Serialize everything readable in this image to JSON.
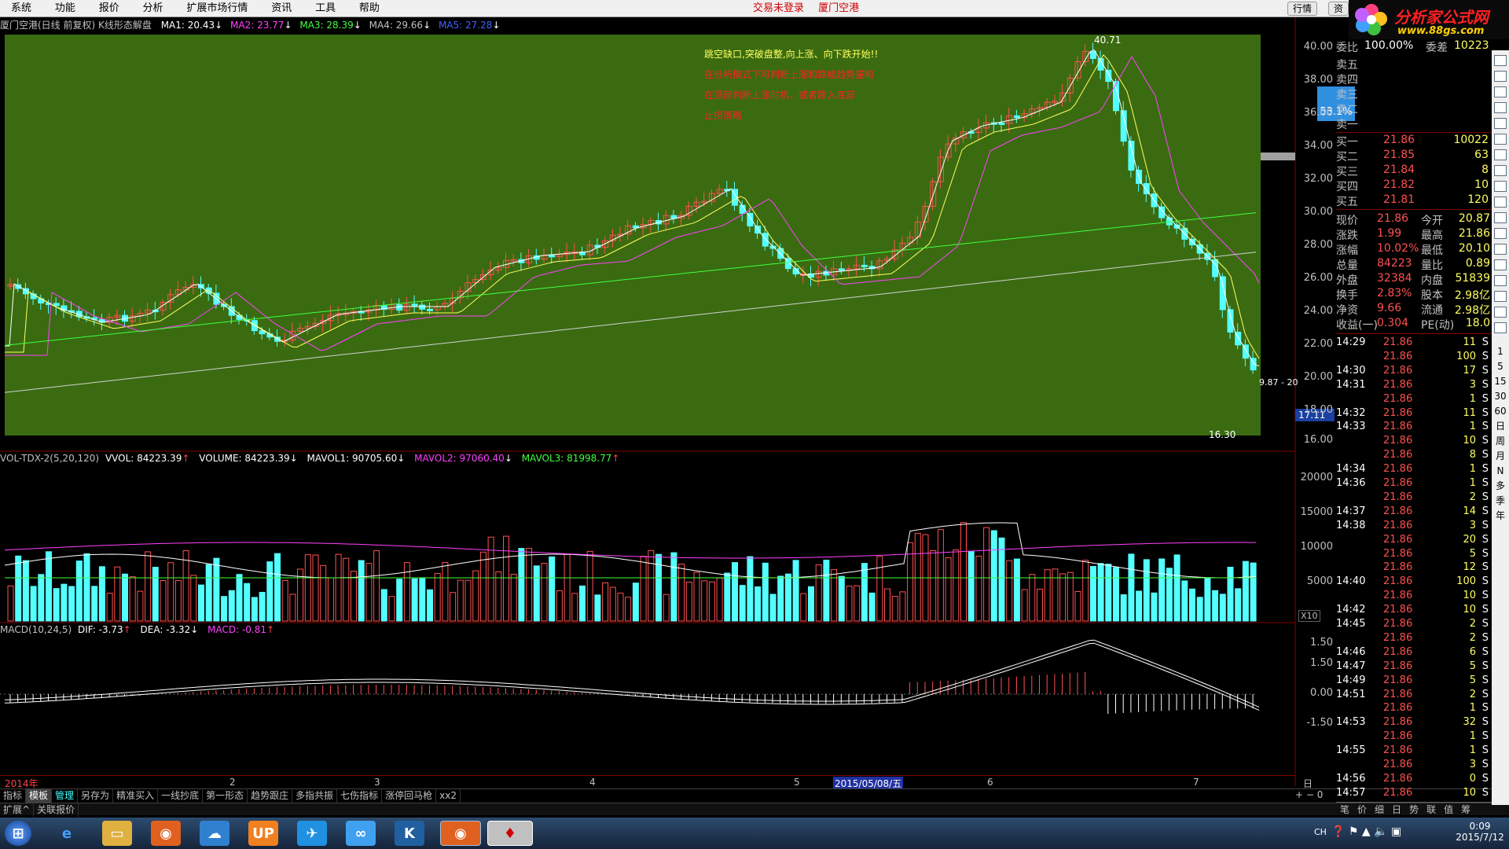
{
  "menu": [
    "系统",
    "功能",
    "报价",
    "分析",
    "扩展市场行情",
    "资讯",
    "工具",
    "帮助"
  ],
  "login_info": "交易未登录",
  "stock_title": "厦门空港",
  "top_buttons": [
    "行情",
    "资"
  ],
  "logo_text": "分析家公式网",
  "logo_url": "www.88gs.com",
  "chart_header": {
    "name": "厦门空港(日线 前复权) K线形态解盘",
    "ma1": "MA1: 20.43",
    "ma2": "MA2: 23.77",
    "ma3": "MA3: 28.39",
    "ma4": "MA4: 29.66",
    "ma5": "MA5: 27.28"
  },
  "annotations": {
    "line1": "跳空缺口,突破盘整,向上涨、向下跌开始!!",
    "line2": "在分析模式下可判断上涨和跌幅趋势量和",
    "line3": "在顶部判断上涨时机，或者跌入底部",
    "line4": "止损策略",
    "high_label": "40.71",
    "low_label": "16.30",
    "price_tag": "17.11",
    "scale_tag": "9.87 - 20",
    "pct_badge": "53.1%"
  },
  "price_axis": [
    "40.00",
    "38.00",
    "36.00",
    "34.00",
    "32.00",
    "30.00",
    "28.00",
    "26.00",
    "24.00",
    "22.00",
    "20.00",
    "18.00",
    "16.00"
  ],
  "vol_header": {
    "name": "VOL-TDX-2(5,20,120)",
    "vvol": "VVOL: 84223.39",
    "volume": "VOLUME: 84223.39",
    "mavol1": "MAVOL1: 90705.60",
    "mavol2": "MAVOL2: 97060.40",
    "mavol3": "MAVOL3: 81998.77"
  },
  "vol_axis": [
    "20000",
    "15000",
    "10000",
    "5000"
  ],
  "vol_unit": "X10",
  "macd_header": {
    "name": "MACD(10,24,5)",
    "dif": "DIF: -3.73",
    "dea": "DEA: -3.32",
    "macd": "MACD: -0.81"
  },
  "macd_axis": [
    "1.50",
    "0.00",
    "-1.50"
  ],
  "x_axis": {
    "labels": [
      "2014年",
      "2",
      "3",
      "4",
      "5",
      "6",
      "7"
    ],
    "cursor_date": "2015/05/08/五",
    "period": "日线"
  },
  "bottom_tabs": [
    "指标",
    "模板",
    "管理",
    "另存为",
    "精准买入",
    "一线抄底",
    "第一形态",
    "趋势跟庄",
    "多指共振",
    "七伤指标",
    "涨停回马枪",
    "xx2"
  ],
  "ext_tabs": [
    "扩展^",
    "关联报价"
  ],
  "order_book": {
    "header": [
      {
        "label": "委比",
        "value": "100.00%"
      },
      {
        "label": "委差",
        "value": "10223"
      }
    ],
    "sells": [
      "卖五",
      "卖四",
      "卖三",
      "卖二",
      "卖一"
    ],
    "buys": [
      {
        "label": "买一",
        "price": "21.86",
        "vol": "10022"
      },
      {
        "label": "买二",
        "price": "21.85",
        "vol": "63"
      },
      {
        "label": "买三",
        "price": "21.84",
        "vol": "8"
      },
      {
        "label": "买四",
        "price": "21.82",
        "vol": "10"
      },
      {
        "label": "买五",
        "price": "21.81",
        "vol": "120"
      }
    ]
  },
  "quote_stats": [
    {
      "l1": "现价",
      "v1": "21.86",
      "l2": "今开",
      "v2": "20.87"
    },
    {
      "l1": "涨跌",
      "v1": "1.99",
      "l2": "最高",
      "v2": "21.86"
    },
    {
      "l1": "涨幅",
      "v1": "10.02%",
      "l2": "最低",
      "v2": "20.10"
    },
    {
      "l1": "总量",
      "v1": "84223",
      "l2": "量比",
      "v2": "0.89"
    },
    {
      "l1": "外盘",
      "v1": "32384",
      "l2": "内盘",
      "v2": "51839"
    },
    {
      "l1": "换手",
      "v1": "2.83%",
      "l2": "股本",
      "v2": "2.98亿"
    },
    {
      "l1": "净资",
      "v1": "9.66",
      "l2": "流通",
      "v2": "2.98亿"
    },
    {
      "l1": "收益(一)",
      "v1": "0.304",
      "l2": "PE(动)",
      "v2": "18.0"
    }
  ],
  "ticks": [
    {
      "t": "14:29",
      "p": "21.86",
      "v": "11",
      "s": "S"
    },
    {
      "t": "",
      "p": "21.86",
      "v": "100",
      "s": "S"
    },
    {
      "t": "14:30",
      "p": "21.86",
      "v": "17",
      "s": "S"
    },
    {
      "t": "14:31",
      "p": "21.86",
      "v": "3",
      "s": "S"
    },
    {
      "t": "",
      "p": "21.86",
      "v": "1",
      "s": "S"
    },
    {
      "t": "14:32",
      "p": "21.86",
      "v": "11",
      "s": "S"
    },
    {
      "t": "14:33",
      "p": "21.86",
      "v": "1",
      "s": "S"
    },
    {
      "t": "",
      "p": "21.86",
      "v": "10",
      "s": "S"
    },
    {
      "t": "",
      "p": "21.86",
      "v": "8",
      "s": "S"
    },
    {
      "t": "14:34",
      "p": "21.86",
      "v": "1",
      "s": "S"
    },
    {
      "t": "14:36",
      "p": "21.86",
      "v": "1",
      "s": "S"
    },
    {
      "t": "",
      "p": "21.86",
      "v": "2",
      "s": "S"
    },
    {
      "t": "14:37",
      "p": "21.86",
      "v": "14",
      "s": "S"
    },
    {
      "t": "14:38",
      "p": "21.86",
      "v": "3",
      "s": "S"
    },
    {
      "t": "",
      "p": "21.86",
      "v": "20",
      "s": "S"
    },
    {
      "t": "",
      "p": "21.86",
      "v": "5",
      "s": "S"
    },
    {
      "t": "",
      "p": "21.86",
      "v": "12",
      "s": "S"
    },
    {
      "t": "14:40",
      "p": "21.86",
      "v": "100",
      "s": "S"
    },
    {
      "t": "",
      "p": "21.86",
      "v": "10",
      "s": "S"
    },
    {
      "t": "14:42",
      "p": "21.86",
      "v": "10",
      "s": "S"
    },
    {
      "t": "14:45",
      "p": "21.86",
      "v": "2",
      "s": "S"
    },
    {
      "t": "",
      "p": "21.86",
      "v": "2",
      "s": "S"
    },
    {
      "t": "14:46",
      "p": "21.86",
      "v": "6",
      "s": "S"
    },
    {
      "t": "14:47",
      "p": "21.86",
      "v": "5",
      "s": "S"
    },
    {
      "t": "14:49",
      "p": "21.86",
      "v": "5",
      "s": "S"
    },
    {
      "t": "14:51",
      "p": "21.86",
      "v": "2",
      "s": "S"
    },
    {
      "t": "",
      "p": "21.86",
      "v": "1",
      "s": "S"
    },
    {
      "t": "14:53",
      "p": "21.86",
      "v": "32",
      "s": "S"
    },
    {
      "t": "",
      "p": "21.86",
      "v": "1",
      "s": "S"
    },
    {
      "t": "14:55",
      "p": "21.86",
      "v": "1",
      "s": "S"
    },
    {
      "t": "",
      "p": "21.86",
      "v": "3",
      "s": "S"
    },
    {
      "t": "14:56",
      "p": "21.86",
      "v": "0",
      "s": "S"
    },
    {
      "t": "14:57",
      "p": "21.86",
      "v": "10",
      "s": "S"
    }
  ],
  "right_bottom_tabs": [
    "笔",
    "价",
    "细",
    "日",
    "势",
    "联",
    "值",
    "筹"
  ],
  "side_period_tabs": [
    "1",
    "5",
    "15",
    "30",
    "60",
    "日",
    "周",
    "月",
    "N",
    "多",
    "季",
    "年"
  ],
  "taskbar": {
    "time": "0:09",
    "date": "2015/7/12",
    "ime": "CH"
  },
  "colors": {
    "up": "#ff5050",
    "down": "#54ffff",
    "bg_chart": "#3a6b10",
    "ma_white": "#ffffff",
    "ma_yellow": "#ffff60",
    "ma_magenta": "#ff40ff",
    "ma_green": "#40ff40"
  }
}
